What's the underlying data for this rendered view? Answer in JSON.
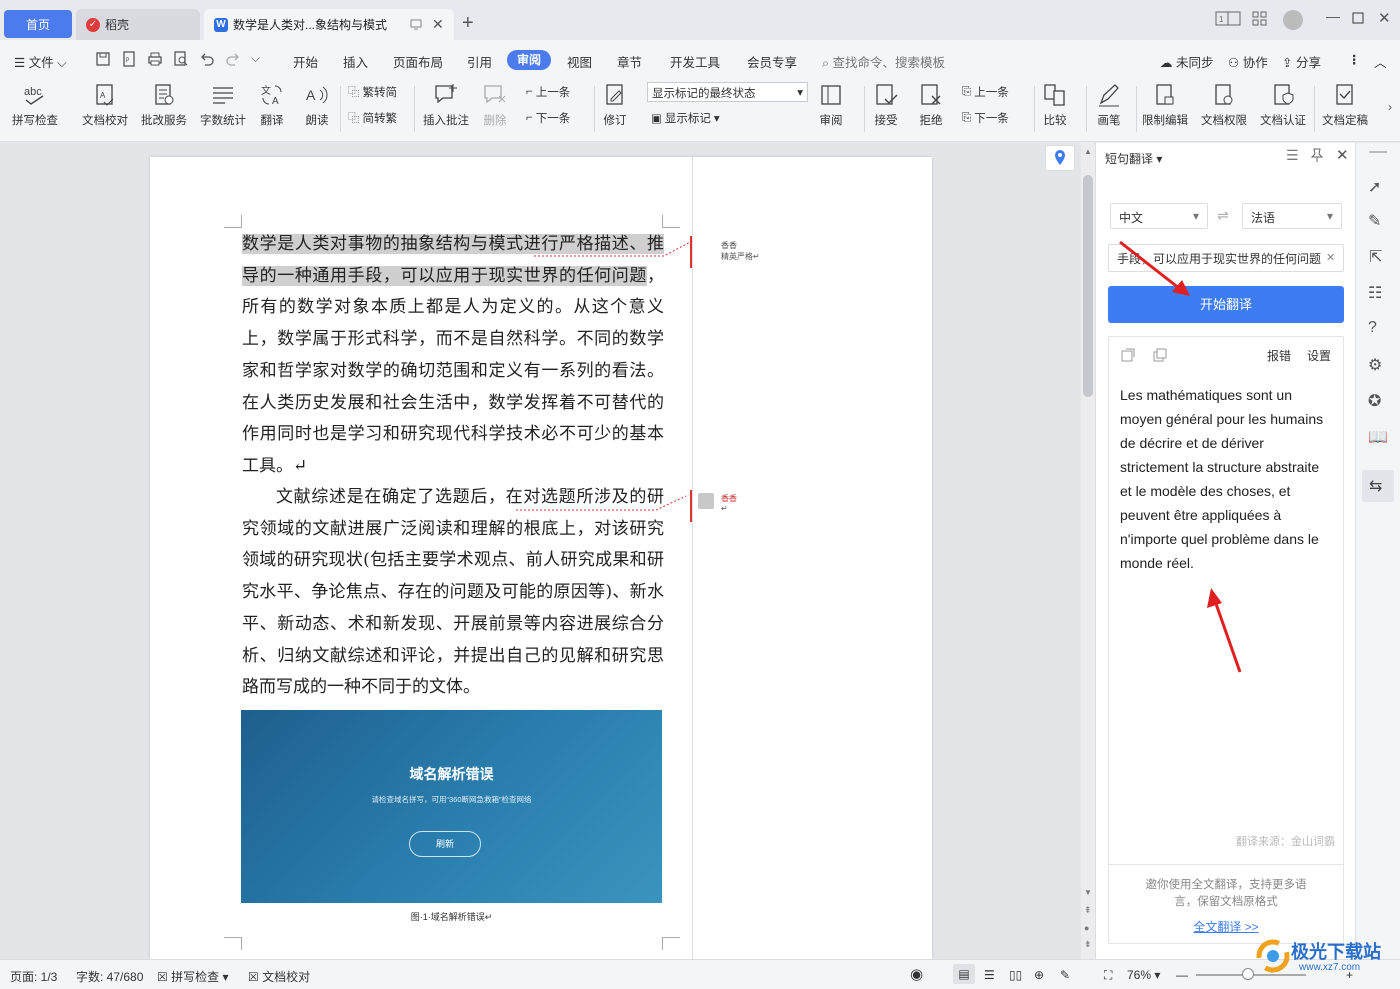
{
  "tabs": {
    "home": "首页",
    "daoke": "稻壳",
    "doc": "数学是人类对...象结构与模式",
    "new_tab": "+"
  },
  "menu": {
    "file": "文件",
    "items": [
      "开始",
      "插入",
      "页面布局",
      "引用",
      "审阅",
      "视图",
      "章节",
      "开发工具",
      "会员专享"
    ],
    "search_placeholder": "查找命令、搜索模板",
    "sync": "未同步",
    "collab": "协作",
    "share": "分享"
  },
  "toolbar": {
    "spell_check": "拼写检查",
    "doc_proof": "文档校对",
    "correction": "批改服务",
    "word_count": "字数统计",
    "translate": "翻译",
    "read_aloud": "朗读",
    "to_traditional": "繁转简",
    "to_simplified": "简转繁",
    "insert_comment": "插入批注",
    "delete": "删除",
    "prev": "上一条",
    "next": "下一条",
    "track": "修订",
    "markup_mode": "显示标记的最终状态",
    "show_markup": "显示标记",
    "review": "审阅",
    "accept": "接受",
    "reject": "拒绝",
    "prev2": "上一条",
    "next2": "下一条",
    "compare": "比较",
    "pen": "画笔",
    "restrict_edit": "限制编辑",
    "doc_permission": "文档权限",
    "doc_cert": "文档认证",
    "doc_finalize": "文档定稿"
  },
  "document": {
    "para1_highlight": "数学是人类对事物的抽象结构与模式进行严格描述、推导的一种通用手段，可以应用于现实世界的任何问题",
    "para1_rest": "，所有的数学对象本质上都是人为定义的。从这个意义上，数学属于形式科学，而不是自然科学。不同的数学家和哲学家对数学的确切范围和定义有一系列的看法。在人类历史发展和社会生活中，数学发挥着不可替代的作用同时也是学习和研究现代科学技术必不可少的基本工具。↵",
    "para2": "文献综述是在确定了选题后，在对选题所涉及的研究领域的文献进展广泛阅读和理解的根底上，对该研究领域的研究现状(包括主要学术观点、前人研究成果和研究水平、争论焦点、存在的问题及可能的原因等)、新水平、新动态、术和新发现、开展前景等内容进展综合分析、归纳文献综述和评论，并提出自己的见解和研究思路而写成的一种不同于的文体。",
    "comment1_author": "香香",
    "comment1_text": "精英严格↵",
    "comment2_author": "香香",
    "comment2_text": "↵",
    "image_title": "域名解析错误",
    "image_subtitle": "请检查域名拼写，可用“360断网急救箱”检查网络",
    "image_button": "刷新",
    "caption": "图·1·域名解析错误↵"
  },
  "pane": {
    "title": "短句翻译",
    "source_lang": "中文",
    "target_lang": "法语",
    "input_text": "手段，可以应用于现实世界的任何问题",
    "translate_button": "开始翻译",
    "report": "报错",
    "settings": "设置",
    "result": "Les mathématiques sont un moyen général pour les humains de décrire et de dériver strictement la structure abstraite et le modèle des choses, et peuvent être appliquées à n'importe quel problème dans le monde réel.",
    "source_note": "翻译来源：金山词霸",
    "promo": "邀你使用全文翻译，支持更多语言，保留文档原格式",
    "full_translate_link": "全文翻译 >>"
  },
  "statusbar": {
    "page": "页面: 1/3",
    "word_count": "字数: 47/680",
    "spell_check": "拼写检查",
    "doc_proof": "文档校对",
    "zoom": "76%"
  },
  "watermark": "极光下载站",
  "watermark_url": "www.xz7.com",
  "colors": {
    "accent": "#4b7bec",
    "button": "#3d7cf2",
    "arrow": "#e02020"
  }
}
